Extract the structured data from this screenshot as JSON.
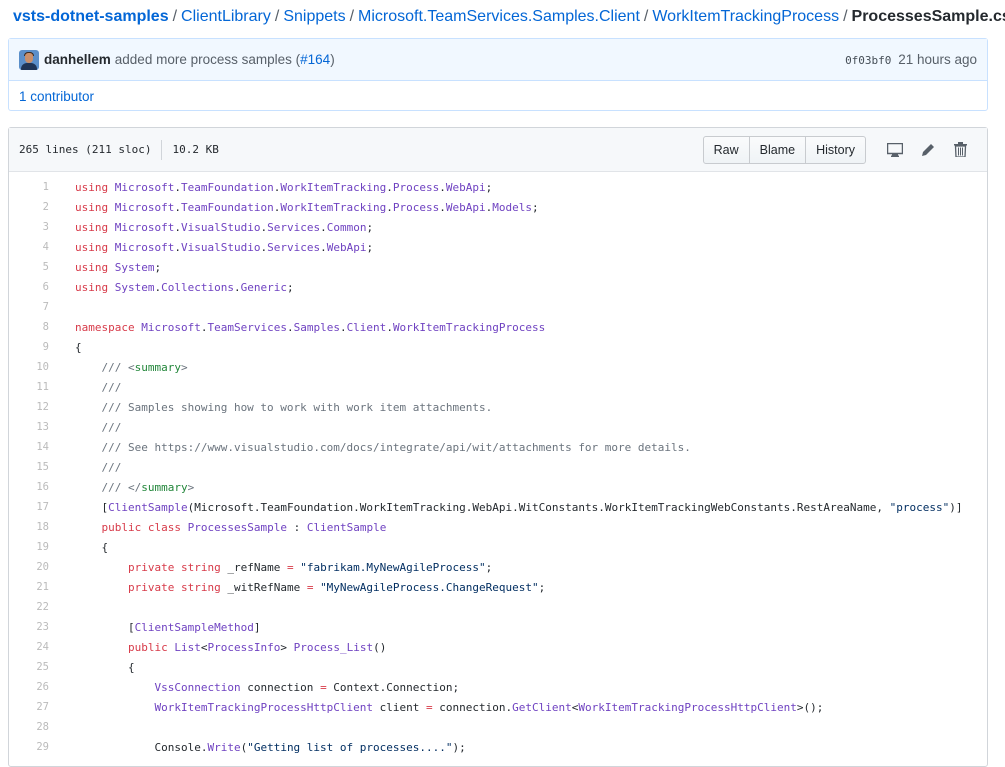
{
  "breadcrumb": {
    "repo": "vsts-dotnet-samples",
    "parts": [
      "ClientLibrary",
      "Snippets",
      "Microsoft.TeamServices.Samples.Client",
      "WorkItemTrackingProcess"
    ],
    "file": "ProcessesSample.cs",
    "separator": "/"
  },
  "commit": {
    "author": "danhellem",
    "message": "added more process samples",
    "pr_open": "(",
    "pr_link": "#164",
    "pr_close": ")",
    "sha": "0f03bf0",
    "time": "21 hours ago",
    "contributors": "1 contributor"
  },
  "file": {
    "lines_info": "265 lines (211 sloc)",
    "size": "10.2 KB",
    "buttons": {
      "raw": "Raw",
      "blame": "Blame",
      "history": "History"
    },
    "icons": [
      "desktop-icon",
      "pencil-icon",
      "trash-icon"
    ]
  },
  "colors": {
    "link": "#0366d6",
    "keyword": "#d73a49",
    "entity": "#6f42c1",
    "string": "#032f62",
    "comment": "#6a737d",
    "tag": "#22863a"
  },
  "code": [
    {
      "n": "1",
      "tokens": [
        [
          "k",
          "using"
        ],
        [
          "",
          ""
        ],
        [
          "",
          " "
        ],
        [
          "e",
          "Microsoft"
        ],
        [
          "",
          "."
        ],
        [
          "e",
          "TeamFoundation"
        ],
        [
          "",
          "."
        ],
        [
          "e",
          "WorkItemTracking"
        ],
        [
          "",
          "."
        ],
        [
          "e",
          "Process"
        ],
        [
          "",
          "."
        ],
        [
          "e",
          "WebApi"
        ],
        [
          "",
          ";"
        ]
      ]
    },
    {
      "n": "2",
      "tokens": [
        [
          "k",
          "using"
        ],
        [
          "",
          " "
        ],
        [
          "e",
          "Microsoft"
        ],
        [
          "",
          "."
        ],
        [
          "e",
          "TeamFoundation"
        ],
        [
          "",
          "."
        ],
        [
          "e",
          "WorkItemTracking"
        ],
        [
          "",
          "."
        ],
        [
          "e",
          "Process"
        ],
        [
          "",
          "."
        ],
        [
          "e",
          "WebApi"
        ],
        [
          "",
          "."
        ],
        [
          "e",
          "Models"
        ],
        [
          "",
          ";"
        ]
      ]
    },
    {
      "n": "3",
      "tokens": [
        [
          "k",
          "using"
        ],
        [
          "",
          " "
        ],
        [
          "e",
          "Microsoft"
        ],
        [
          "",
          "."
        ],
        [
          "e",
          "VisualStudio"
        ],
        [
          "",
          "."
        ],
        [
          "e",
          "Services"
        ],
        [
          "",
          "."
        ],
        [
          "e",
          "Common"
        ],
        [
          "",
          ";"
        ]
      ]
    },
    {
      "n": "4",
      "tokens": [
        [
          "k",
          "using"
        ],
        [
          "",
          " "
        ],
        [
          "e",
          "Microsoft"
        ],
        [
          "",
          "."
        ],
        [
          "e",
          "VisualStudio"
        ],
        [
          "",
          "."
        ],
        [
          "e",
          "Services"
        ],
        [
          "",
          "."
        ],
        [
          "e",
          "WebApi"
        ],
        [
          "",
          ";"
        ]
      ]
    },
    {
      "n": "5",
      "tokens": [
        [
          "k",
          "using"
        ],
        [
          "",
          " "
        ],
        [
          "e",
          "System"
        ],
        [
          "",
          ";"
        ]
      ]
    },
    {
      "n": "6",
      "tokens": [
        [
          "k",
          "using"
        ],
        [
          "",
          " "
        ],
        [
          "e",
          "System"
        ],
        [
          "",
          "."
        ],
        [
          "e",
          "Collections"
        ],
        [
          "",
          "."
        ],
        [
          "e",
          "Generic"
        ],
        [
          "",
          ";"
        ]
      ]
    },
    {
      "n": "7",
      "tokens": []
    },
    {
      "n": "8",
      "tokens": [
        [
          "k",
          "namespace"
        ],
        [
          "",
          " "
        ],
        [
          "e",
          "Microsoft"
        ],
        [
          "",
          "."
        ],
        [
          "e",
          "TeamServices"
        ],
        [
          "",
          "."
        ],
        [
          "e",
          "Samples"
        ],
        [
          "",
          "."
        ],
        [
          "e",
          "Client"
        ],
        [
          "",
          "."
        ],
        [
          "e",
          "WorkItemTrackingProcess"
        ]
      ]
    },
    {
      "n": "9",
      "tokens": [
        [
          "",
          "{"
        ]
      ]
    },
    {
      "n": "10",
      "tokens": [
        [
          "c",
          "    /// "
        ],
        [
          "c",
          "<"
        ],
        [
          "t",
          "summary"
        ],
        [
          "c",
          ">"
        ]
      ]
    },
    {
      "n": "11",
      "tokens": [
        [
          "c",
          "    ///"
        ]
      ]
    },
    {
      "n": "12",
      "tokens": [
        [
          "c",
          "    /// Samples showing how to work with work item attachments."
        ]
      ]
    },
    {
      "n": "13",
      "tokens": [
        [
          "c",
          "    ///"
        ]
      ]
    },
    {
      "n": "14",
      "tokens": [
        [
          "c",
          "    /// See https://www.visualstudio.com/docs/integrate/api/wit/attachments for more details."
        ]
      ]
    },
    {
      "n": "15",
      "tokens": [
        [
          "c",
          "    ///"
        ]
      ]
    },
    {
      "n": "16",
      "tokens": [
        [
          "c",
          "    /// </"
        ],
        [
          "t",
          "summary"
        ],
        [
          "c",
          ">"
        ]
      ]
    },
    {
      "n": "17",
      "tokens": [
        [
          "",
          "    ["
        ],
        [
          "e",
          "ClientSample"
        ],
        [
          "",
          "(Microsoft.TeamFoundation.WorkItemTracking.WebApi.WitConstants.WorkItemTrackingWebConstants.RestAreaName, "
        ],
        [
          "s",
          "\"process\""
        ],
        [
          "",
          ")]"
        ]
      ]
    },
    {
      "n": "18",
      "tokens": [
        [
          "",
          "    "
        ],
        [
          "k",
          "public"
        ],
        [
          "",
          " "
        ],
        [
          "k",
          "class"
        ],
        [
          "",
          " "
        ],
        [
          "e",
          "ProcessesSample"
        ],
        [
          "",
          " : "
        ],
        [
          "e",
          "ClientSample"
        ]
      ]
    },
    {
      "n": "19",
      "tokens": [
        [
          "",
          "    {"
        ]
      ]
    },
    {
      "n": "20",
      "tokens": [
        [
          "",
          "        "
        ],
        [
          "k",
          "private"
        ],
        [
          "",
          " "
        ],
        [
          "k",
          "string"
        ],
        [
          "",
          " _refName "
        ],
        [
          "k",
          "="
        ],
        [
          "",
          " "
        ],
        [
          "s",
          "\"fabrikam.MyNewAgileProcess\""
        ],
        [
          "",
          ";"
        ]
      ]
    },
    {
      "n": "21",
      "tokens": [
        [
          "",
          "        "
        ],
        [
          "k",
          "private"
        ],
        [
          "",
          " "
        ],
        [
          "k",
          "string"
        ],
        [
          "",
          " _witRefName "
        ],
        [
          "k",
          "="
        ],
        [
          "",
          " "
        ],
        [
          "s",
          "\"MyNewAgileProcess.ChangeRequest\""
        ],
        [
          "",
          ";"
        ]
      ]
    },
    {
      "n": "22",
      "tokens": []
    },
    {
      "n": "23",
      "tokens": [
        [
          "",
          "        ["
        ],
        [
          "e",
          "ClientSampleMethod"
        ],
        [
          "",
          "]"
        ]
      ]
    },
    {
      "n": "24",
      "tokens": [
        [
          "",
          "        "
        ],
        [
          "k",
          "public"
        ],
        [
          "",
          " "
        ],
        [
          "e",
          "List"
        ],
        [
          "",
          "<"
        ],
        [
          "e",
          "ProcessInfo"
        ],
        [
          "",
          "> "
        ],
        [
          "e",
          "Process_List"
        ],
        [
          "",
          "()"
        ]
      ]
    },
    {
      "n": "25",
      "tokens": [
        [
          "",
          "        {"
        ]
      ]
    },
    {
      "n": "26",
      "tokens": [
        [
          "",
          "            "
        ],
        [
          "e",
          "VssConnection"
        ],
        [
          "",
          " connection "
        ],
        [
          "k",
          "="
        ],
        [
          "",
          " Context.Connection;"
        ]
      ]
    },
    {
      "n": "27",
      "tokens": [
        [
          "",
          "            "
        ],
        [
          "e",
          "WorkItemTrackingProcessHttpClient"
        ],
        [
          "",
          " client "
        ],
        [
          "k",
          "="
        ],
        [
          "",
          " connection."
        ],
        [
          "e",
          "GetClient"
        ],
        [
          "",
          "<"
        ],
        [
          "e",
          "WorkItemTrackingProcessHttpClient"
        ],
        [
          "",
          ">();"
        ]
      ]
    },
    {
      "n": "28",
      "tokens": []
    },
    {
      "n": "29",
      "tokens": [
        [
          "",
          "            Console."
        ],
        [
          "e",
          "Write"
        ],
        [
          "",
          "("
        ],
        [
          "s",
          "\"Getting list of processes....\""
        ],
        [
          "",
          ");"
        ]
      ]
    }
  ]
}
